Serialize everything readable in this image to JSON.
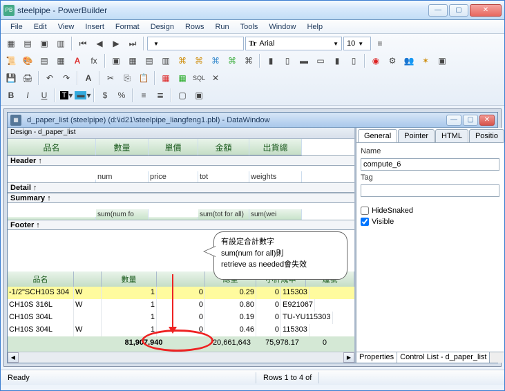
{
  "app": {
    "title": "steelpipe - PowerBuilder"
  },
  "menus": [
    "File",
    "Edit",
    "View",
    "Insert",
    "Format",
    "Design",
    "Rows",
    "Run",
    "Tools",
    "Window",
    "Help"
  ],
  "font": {
    "name": "Arial",
    "size": "10"
  },
  "child": {
    "title": "d_paper_list  (steelpipe) (d:\\id21\\steelpipe_liangfeng1.pbl) - DataWindow"
  },
  "design": {
    "caption": "Design - d_paper_list",
    "bands": {
      "header": "Header ↑",
      "detail": "Detail ↑",
      "summary": "Summary ↑",
      "footer": "Footer ↑"
    },
    "headers": [
      "品名",
      "數量",
      "單價",
      "金額",
      "出貨總"
    ],
    "detail": [
      "",
      "num",
      "price",
      "tot",
      "weights"
    ],
    "summary": [
      "",
      "sum(num fo",
      "",
      "sum(tot for all)",
      "sum(wei"
    ]
  },
  "callout": {
    "l1": "有設定合計數字",
    "l2": "sum(num for all)則",
    "l3": "retrieve as needed會失效"
  },
  "props": {
    "tabs": [
      "General",
      "Pointer",
      "HTML",
      "Positio"
    ],
    "name_label": "Name",
    "name_value": "compute_6",
    "tag_label": "Tag",
    "tag_value": "",
    "hide": "HideSnaked",
    "visible": "Visible",
    "bottom_tabs": [
      "Properties",
      "Control List - d_paper_list"
    ]
  },
  "preview": {
    "headers": [
      "品名",
      "",
      "數量",
      "",
      "",
      "總重",
      "小計成本",
      "爐號"
    ],
    "rows": [
      {
        "a": "-1/2\"SCH10S 304",
        "b": "W",
        "c": "1",
        "d": "0",
        "e": "0.29",
        "f": "0",
        "g": "115303"
      },
      {
        "a": "CH10S 316L",
        "b": "W",
        "c": "1",
        "d": "0",
        "e": "0.80",
        "f": "0",
        "g": "E921067"
      },
      {
        "a": "CH10S 304L",
        "b": "",
        "c": "1",
        "d": "0",
        "e": "0.19",
        "f": "0",
        "g": "TU-YU115303"
      },
      {
        "a": "CH10S 304L",
        "b": "W",
        "c": "1",
        "d": "0",
        "e": "0.46",
        "f": "0",
        "g": "115303"
      }
    ],
    "totals": {
      "num": "81,907.940",
      "tot": "20,661,643",
      "wt": "75,978.17",
      "cost": "0"
    }
  },
  "status": {
    "ready": "Ready",
    "rows": "Rows 1 to 4 of"
  }
}
